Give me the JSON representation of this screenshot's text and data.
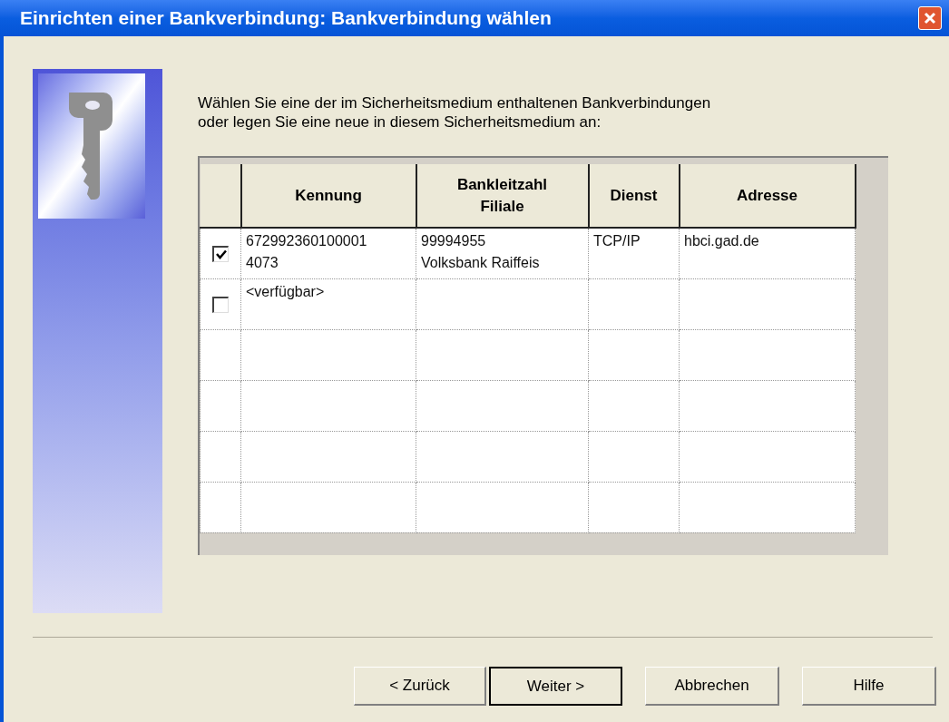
{
  "window": {
    "title": "Einrichten einer Bankverbindung: Bankverbindung wählen"
  },
  "instruction": "Wählen Sie eine der im Sicherheitsmedium enthaltenen Bankverbindungen\noder legen Sie eine neue in diesem Sicherheitsmedium an:",
  "table": {
    "columns": [
      "Kennung",
      "Bankleitzahl\nFiliale",
      "Dienst",
      "Adresse"
    ],
    "rows": [
      {
        "checked": true,
        "cells": [
          "672992360100001\n4073",
          "99994955\nVolksbank Raiffeis",
          "TCP/IP",
          "hbci.gad.de"
        ]
      },
      {
        "checked": false,
        "cells": [
          "<verfügbar>"
        ]
      }
    ]
  },
  "buttons": [
    {
      "label": "< Zurück",
      "default": false
    },
    {
      "label": "Weiter >",
      "default": true
    },
    {
      "label": "Abbrechen",
      "default": false
    },
    {
      "label": "Hilfe",
      "default": false
    }
  ]
}
